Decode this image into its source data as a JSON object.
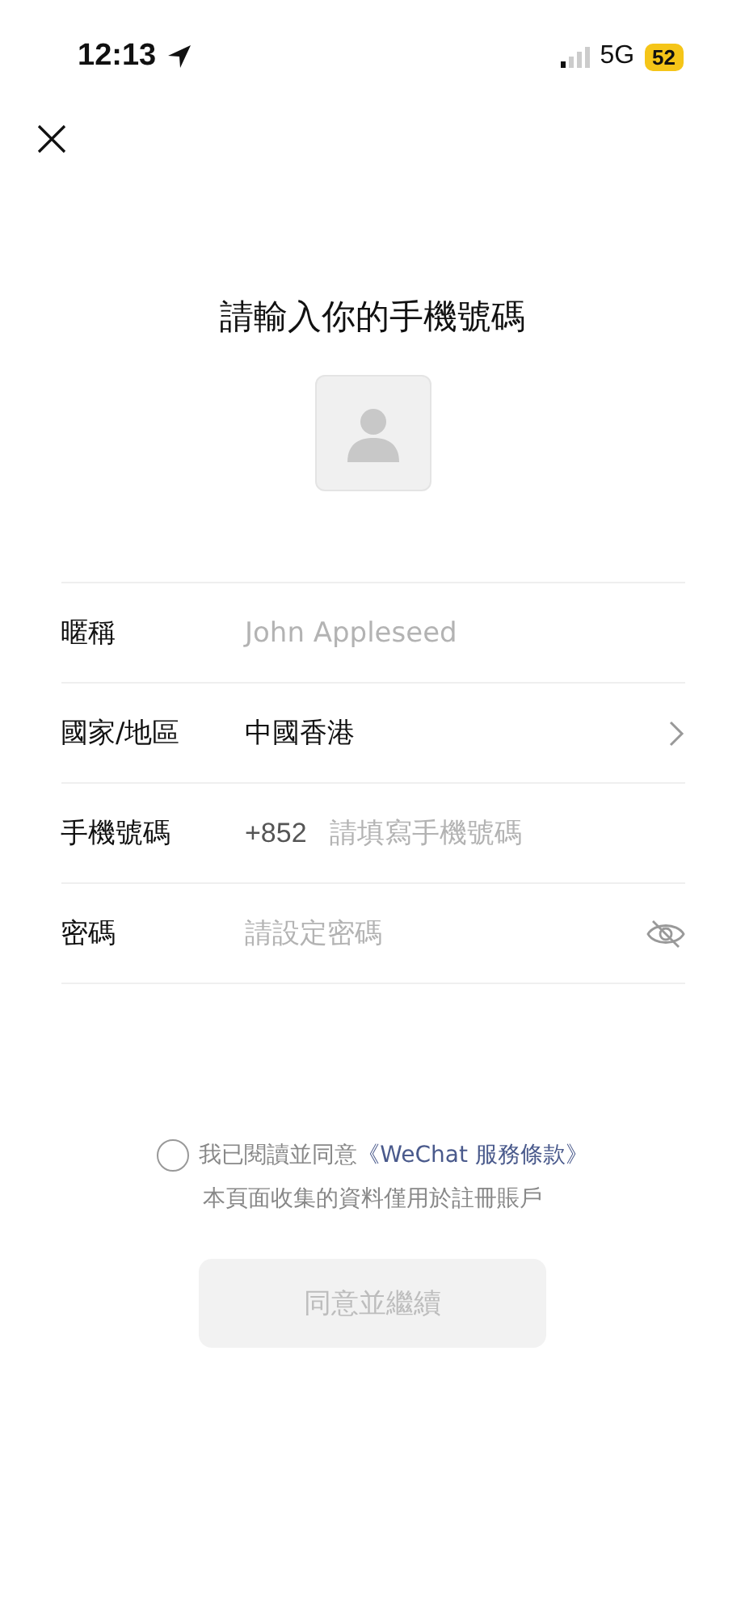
{
  "status_bar": {
    "time": "12:13",
    "network": "5G",
    "battery": "52"
  },
  "title": "請輸入你的手機號碼",
  "form": [
    {
      "kind": "text",
      "label": "暱稱",
      "placeholder": "John Appleseed"
    },
    {
      "kind": "select",
      "label": "國家/地區",
      "value": "中國香港"
    },
    {
      "kind": "phone",
      "label": "手機號碼",
      "prefix": "+852",
      "placeholder": "請填寫手機號碼"
    },
    {
      "kind": "password",
      "label": "密碼",
      "placeholder": "請設定密碼"
    }
  ],
  "agreement": {
    "checked": false,
    "text": "我已閱讀並同意",
    "link": "《WeChat 服務條款》",
    "note": "本頁面收集的資料僅用於註冊賬戶"
  },
  "submit": {
    "label": "同意並繼續",
    "disabled": true
  }
}
